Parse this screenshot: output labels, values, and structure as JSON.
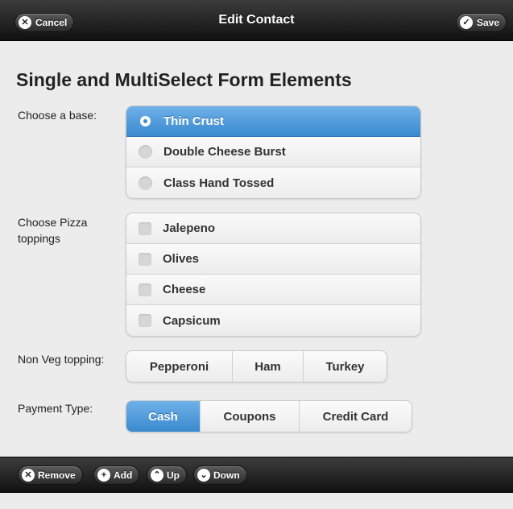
{
  "header": {
    "title": "Edit Contact",
    "cancel_label": "Cancel",
    "save_label": "Save"
  },
  "form": {
    "heading": "Single and MultiSelect Form Elements",
    "base": {
      "label": "Choose a base:",
      "selected": "Thin Crust",
      "options": [
        "Thin Crust",
        "Double Cheese Burst",
        "Class Hand Tossed"
      ]
    },
    "toppings": {
      "label": "Choose Pizza toppings",
      "options": [
        "Jalepeno",
        "Olives",
        "Cheese",
        "Capsicum"
      ],
      "checked": []
    },
    "nonveg": {
      "label": "Non Veg topping:",
      "options": [
        "Pepperoni",
        "Ham",
        "Turkey"
      ],
      "selected": ""
    },
    "payment": {
      "label": "Payment Type:",
      "options": [
        "Cash",
        "Coupons",
        "Credit Card"
      ],
      "selected": "Cash"
    }
  },
  "footer": {
    "remove_label": "Remove",
    "add_label": "Add",
    "up_label": "Up",
    "down_label": "Down"
  },
  "colors": {
    "accent": "#3a89cf",
    "bar": "#1e1e1e"
  }
}
